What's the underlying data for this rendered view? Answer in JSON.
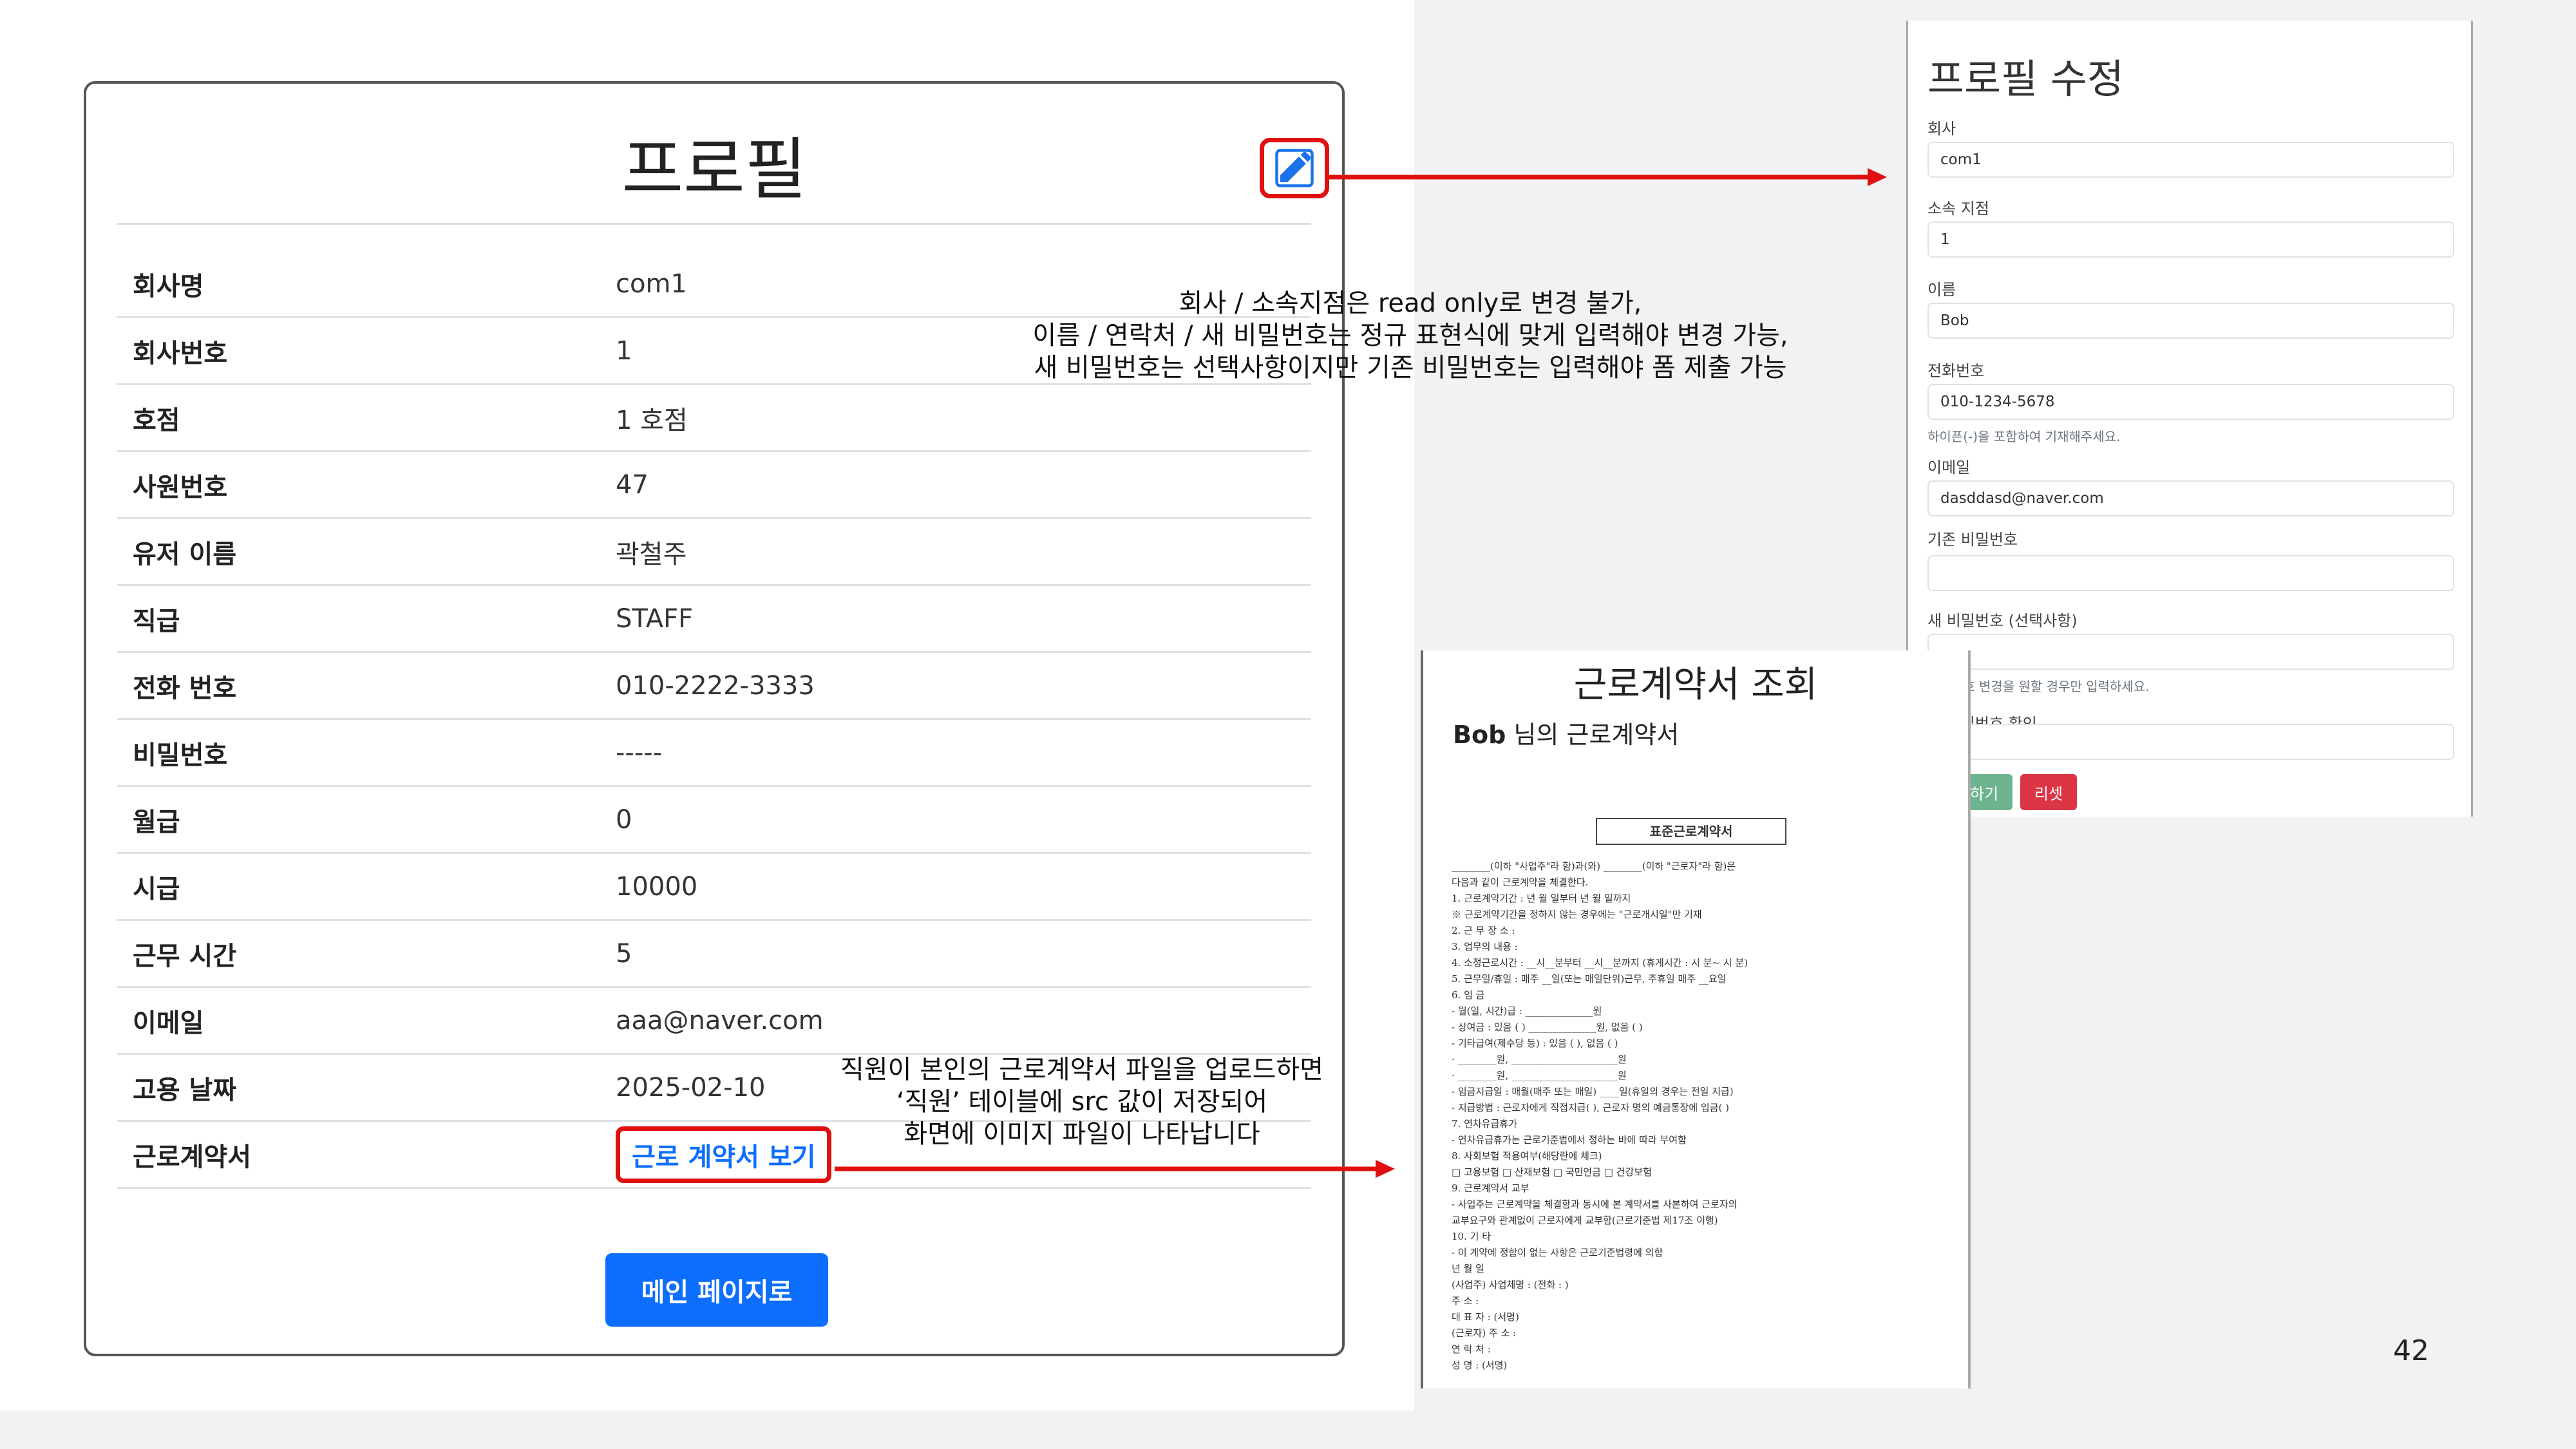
{
  "profile": {
    "title": "프로필",
    "rows": [
      {
        "label": "회사명",
        "value": "com1"
      },
      {
        "label": "회사번호",
        "value": "1"
      },
      {
        "label": "호점",
        "value": "1 호점"
      },
      {
        "label": "사원번호",
        "value": "47"
      },
      {
        "label": "유저 이름",
        "value": "곽철주"
      },
      {
        "label": "직급",
        "value": "STAFF"
      },
      {
        "label": "전화 번호",
        "value": "010-2222-3333"
      },
      {
        "label": "비밀번호",
        "value": "-----"
      },
      {
        "label": "월급",
        "value": "0"
      },
      {
        "label": "시급",
        "value": "10000"
      },
      {
        "label": "근무 시간",
        "value": "5"
      },
      {
        "label": "이메일",
        "value": "aaa@naver.com"
      },
      {
        "label": "고용 날짜",
        "value": "2025-02-10"
      },
      {
        "label": "근로계약서",
        "link": "근로 계약서 보기"
      }
    ],
    "main_button": "메인 페이지로",
    "edit_icon": "edit-pencil-icon"
  },
  "annotations": {
    "edit_note": [
      "회사 / 소속지점은 read only로 변경 불가,",
      "이름 / 연락처 / 새 비밀번호는 정규 표현식에 맞게 입력해야 변경 가능,",
      "새 비밀번호는 선택사항이지만 기존 비밀번호는 입력해야 폼 제출 가능"
    ],
    "contract_note": [
      "직원이 본인의 근로계약서 파일을 업로드하면",
      "‘직원’ 테이블에 src 값이 저장되어",
      "화면에 이미지 파일이 나타납니다"
    ],
    "arrow_color": "#e01010"
  },
  "edit_form": {
    "title": "프로필 수정",
    "company_label": "회사",
    "company_value": "com1",
    "branch_label": "소속 지점",
    "branch_value": "1",
    "name_label": "이름",
    "name_value": "Bob",
    "phone_label": "전화번호",
    "phone_value": "010-1234-5678",
    "phone_help": "하이픈(-)을 포함하여 기재해주세요.",
    "email_label": "이메일",
    "email_value": "dasddasd@naver.com",
    "current_pw_label": "기존 비밀번호",
    "new_pw_label": "새 비밀번호 (선택사항)",
    "new_pw_help": "비밀번호 변경을 원할 경우만 입력하세요.",
    "confirm_pw_label": "새 비밀번호 확인",
    "submit": "수정하기",
    "reset": "리셋"
  },
  "contract_view": {
    "title": "근로계약서 조회",
    "owner": "Bob",
    "subtitle_suffix": " 님의 근로계약서",
    "document": {
      "title": "표준근로계약서",
      "lines": [
        "________(이하 \"사업주\"라 함)과(와) ________(이하 \"근로자\"라 함)은",
        "다음과 같이 근로계약을 체결한다.",
        "1. 근로계약기간 :      년   월   일부터      년   월   일까지",
        "   ※ 근로계약기간을 정하지 않는 경우에는 \"근로개시일\"만 기재",
        "2. 근 무 장 소 :",
        "3. 업무의 내용 :",
        "4. 소정근로시간 : __시__분부터 __시__분까지 (휴게시간 : 시 분~ 시 분)",
        "5. 근무일/휴일 : 매주 __일(또는 매일단위)근무, 주휴일 매주 __요일",
        "6. 임  금",
        "  - 월(일, 시간)급 : ______________원",
        "  - 상여금 : 있음 (   )  ______________원,  없음 (   )",
        "  - 기타급여(제수당 등) : 있음 (   ),  없음 (   )",
        "     · ________원,  ______________________원",
        "     · ________원,  ______________________원",
        "  - 임금지급일 : 매월(매주 또는 매일) ____일(휴일의 경우는 전일 지급)",
        "  - 지급방법 : 근로자에게 직접지급(   ), 근로자 명의 예금통장에 입금(   )",
        "7. 연차유급휴가",
        "  - 연차유급휴가는 근로기준법에서 정하는 바에 따라 부여함",
        "8. 사회보험 적용여부(해당란에 체크)",
        "  □ 고용보험  □ 산재보험  □ 국민연금  □ 건강보험",
        "9. 근로계약서 교부",
        "  - 사업주는 근로계약을 체결함과 동시에 본 계약서를 사본하여 근로자의",
        "    교부요구와 관계없이 근로자에게 교부함(근로기준법 제17조 이행)",
        "10. 기  타",
        "  - 이 계약에 정함이 없는 사항은 근로기준법령에 의함",
        "                         년    월    일",
        "(사업주) 사업체명 :                   (전화 :              )",
        "          주    소 :",
        "          대 표 자 :                   (서명)",
        "(근로자) 주    소 :",
        "          연 락 처 :",
        "          성    명 :                   (서명)"
      ]
    }
  },
  "page_number": "42"
}
